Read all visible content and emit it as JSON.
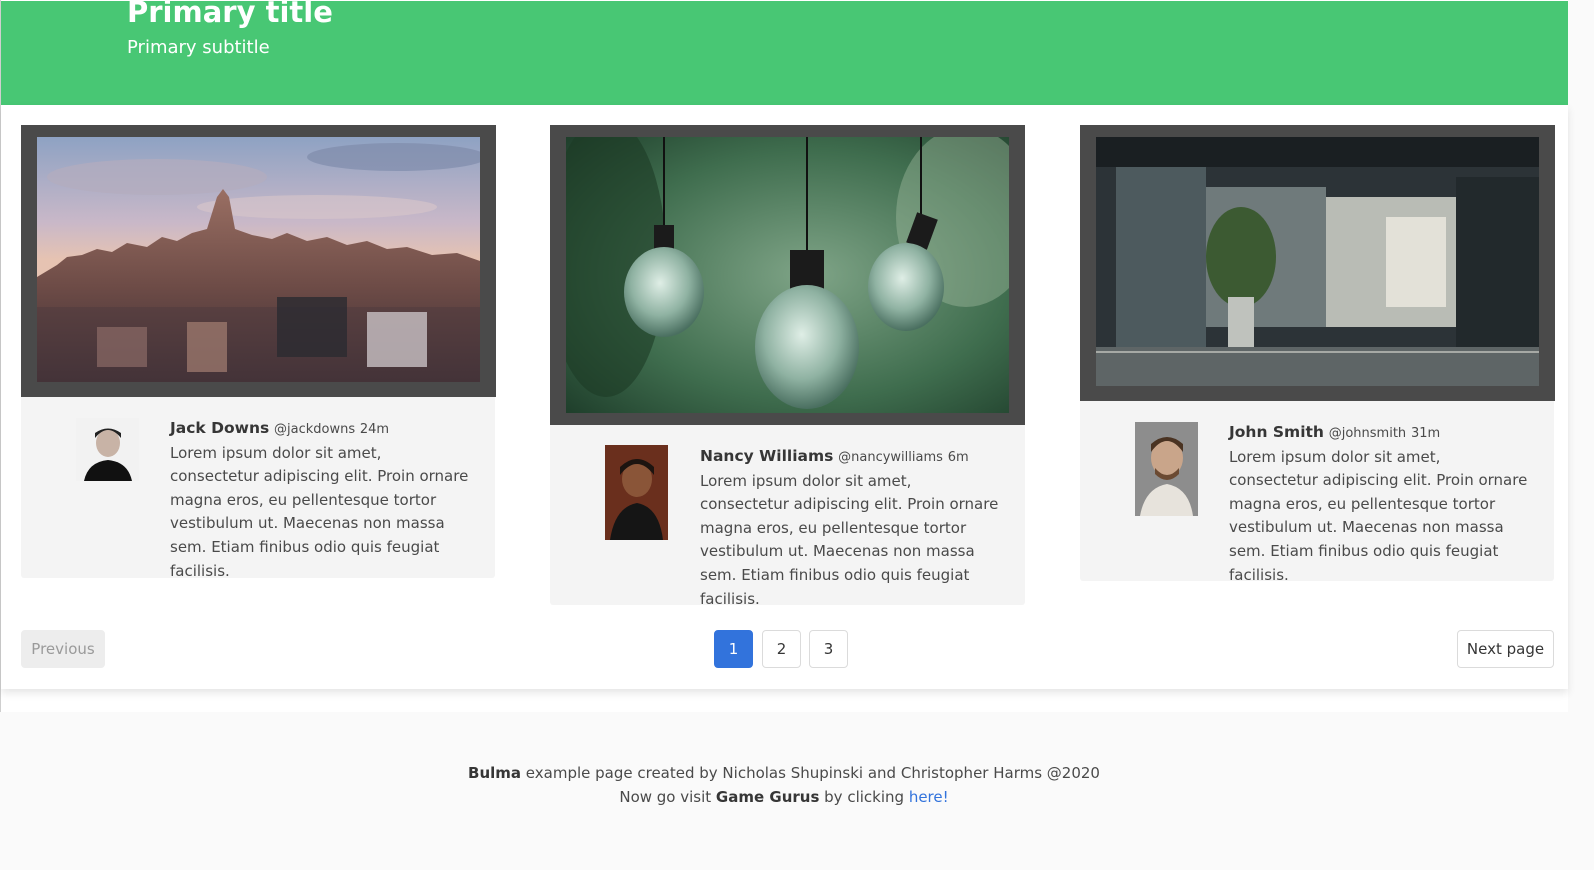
{
  "hero": {
    "title": "Primary title",
    "subtitle": "Primary subtitle",
    "color": "#48c774"
  },
  "cards": [
    {
      "image": "city-skyline-photo",
      "avatar": "man-smiling-black-shirt",
      "name": "Jack Downs",
      "handle": "@jackdowns",
      "time": "24m",
      "body": "Lorem ipsum dolor sit amet, consectetur adipiscing elit. Proin ornare magna eros, eu pellentesque tortor vestibulum ut. Maecenas non massa sem. Etiam finibus odio quis feugiat facilisis."
    },
    {
      "image": "hanging-lightbulbs-photo",
      "avatar": "woman-smiling-black-top",
      "name": "Nancy Williams",
      "handle": "@nancywilliams",
      "time": "6m",
      "body": "Lorem ipsum dolor sit amet, consectetur adipiscing elit. Proin ornare magna eros, eu pellentesque tortor vestibulum ut. Maecenas non massa sem. Etiam finibus odio quis feugiat facilisis."
    },
    {
      "image": "modern-interior-photo",
      "avatar": "man-glasses-beard",
      "name": "John Smith",
      "handle": "@johnsmith",
      "time": "31m",
      "body": "Lorem ipsum dolor sit amet, consectetur adipiscing elit. Proin ornare magna eros, eu pellentesque tortor vestibulum ut. Maecenas non massa sem. Etiam finibus odio quis feugiat facilisis."
    }
  ],
  "pagination": {
    "previous": "Previous",
    "next": "Next page",
    "pages": [
      "1",
      "2",
      "3"
    ],
    "current": "1",
    "current_color": "#3273dc"
  },
  "footer": {
    "brand": "Bulma",
    "line1_rest": " example page created by Nicholas Shupinski and Christopher Harms @2020",
    "line2_pre": "Now go visit ",
    "line2_brand": "Game Gurus",
    "line2_mid": " by clicking ",
    "link": "here!",
    "link_color": "#3273dc"
  }
}
